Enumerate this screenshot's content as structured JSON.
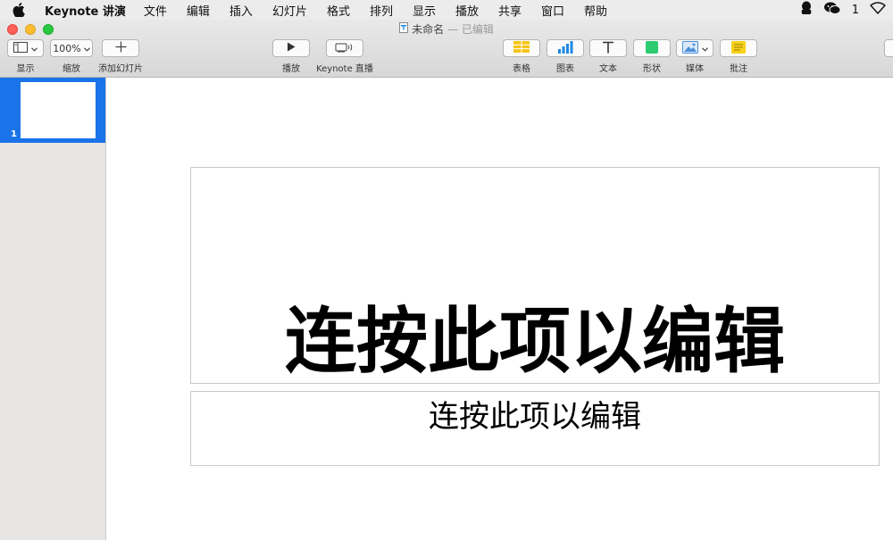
{
  "menubar": {
    "app_name": "Keynote 讲演",
    "items": [
      "文件",
      "编辑",
      "插入",
      "幻灯片",
      "格式",
      "排列",
      "显示",
      "播放",
      "共享",
      "窗口",
      "帮助"
    ],
    "status_number": "1"
  },
  "window": {
    "title": "未命名",
    "edited": "— 已编辑"
  },
  "toolbar": {
    "view_label": "显示",
    "zoom_value": "100%",
    "zoom_label": "缩放",
    "add_slide_label": "添加幻灯片",
    "play_label": "播放",
    "keynote_live_label": "Keynote 直播",
    "table_label": "表格",
    "chart_label": "图表",
    "text_label": "文本",
    "shape_label": "形状",
    "media_label": "媒体",
    "comment_label": "批注"
  },
  "colors": {
    "table_icon": "#f5c518",
    "chart_icon": "#1e88e5",
    "shape_icon": "#2ecc71",
    "media_icon": "#4a90d9",
    "comment_icon": "#f7d21a",
    "selection": "#1a73e8"
  },
  "navigator": {
    "slides": [
      {
        "number": "1"
      }
    ]
  },
  "slide": {
    "title": "连按此项以编辑",
    "subtitle": "连按此项以编辑"
  }
}
